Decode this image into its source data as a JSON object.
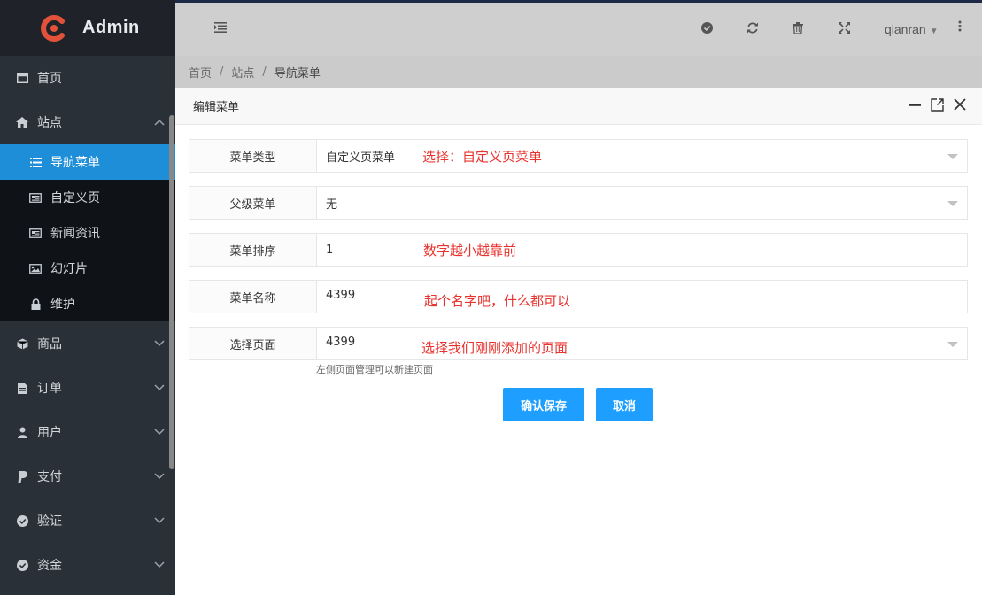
{
  "app": {
    "logo_text": "Admin"
  },
  "sidebar": {
    "items": [
      {
        "label": "首页",
        "icon": "window-icon"
      },
      {
        "label": "站点",
        "icon": "home-icon",
        "expanded": true
      },
      {
        "label": "商品",
        "icon": "cube-icon"
      },
      {
        "label": "订单",
        "icon": "file-icon"
      },
      {
        "label": "用户",
        "icon": "user-icon"
      },
      {
        "label": "支付",
        "icon": "paypal-icon"
      },
      {
        "label": "验证",
        "icon": "check-circle-icon"
      },
      {
        "label": "资金",
        "icon": "check-circle-icon"
      }
    ],
    "sub_items": [
      {
        "label": "导航菜单",
        "icon": "list-icon",
        "active": true
      },
      {
        "label": "自定义页",
        "icon": "newspaper-icon"
      },
      {
        "label": "新闻资讯",
        "icon": "newspaper-icon"
      },
      {
        "label": "幻灯片",
        "icon": "image-icon"
      },
      {
        "label": "维护",
        "icon": "lock-icon"
      }
    ]
  },
  "topbar": {
    "username": "qianran",
    "icons": [
      "check-circle-icon",
      "refresh-icon",
      "trash-icon",
      "fullscreen-icon",
      "more-vertical-icon"
    ]
  },
  "breadcrumb": {
    "items": [
      "首页",
      "站点",
      "导航菜单"
    ],
    "separator": "/"
  },
  "modal": {
    "title": "编辑菜单",
    "fields": [
      {
        "label": "菜单类型",
        "value": "自定义页菜单",
        "annotation": "选择：自定义页菜单",
        "type": "select"
      },
      {
        "label": "父级菜单",
        "value": "无",
        "annotation": "",
        "type": "select"
      },
      {
        "label": "菜单排序",
        "value": "1",
        "annotation": "数字越小越靠前",
        "type": "input"
      },
      {
        "label": "菜单名称",
        "value": "4399",
        "annotation": "起个名字吧，什么都可以",
        "type": "input"
      },
      {
        "label": "选择页面",
        "value": "4399",
        "annotation": "选择我们刚刚添加的页面",
        "type": "select"
      }
    ],
    "hint": "左侧页面管理可以新建页面",
    "confirm_label": "确认保存",
    "cancel_label": "取消"
  },
  "colors": {
    "accent": "#1e9fff",
    "annotation": "#e8322d",
    "sidebar_bg": "#2a3038",
    "active_item": "#1e8ed9"
  }
}
